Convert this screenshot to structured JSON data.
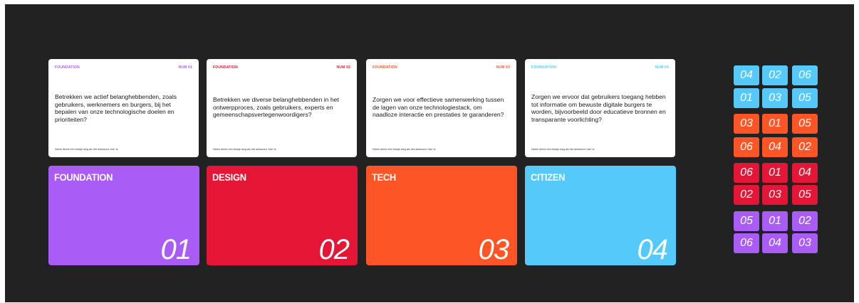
{
  "colors": {
    "board": "#222222",
    "foundation": "#aa5cf7",
    "design": "#e51535",
    "tech": "#fe5526",
    "citizen": "#55c9fa"
  },
  "question_cards": [
    {
      "category": "FOUNDATION",
      "number": "NUM 01",
      "question": "Betrekken we actief belanghebbenden, zoals gebruikers, werknemers en burgers, bij het bepalen van onze technologische doelen en prioriteiten?",
      "note": "Neem direct een blokje weg als het antwoord 'nee' is."
    },
    {
      "category": "FOUNDATION",
      "number": "NUM 02",
      "question": "Betrekken we diverse belanghebbenden in het ontwerpproces, zoals gebruikers, experts en gemeenschapsvertegenwoordigers?",
      "note": "Neem direct een blokje weg als het antwoord 'nee' is."
    },
    {
      "category": "FOUNDATION",
      "number": "NUM 03",
      "question": "Zorgen we voor effectieve samenwerking tussen de lagen van onze technologiestack, om naadloze interactie en prestaties te garanderen?",
      "note": "Neem direct een blokje weg als het antwoord 'nee' is."
    },
    {
      "category": "FOUNDATION",
      "number": "NUM 04",
      "question": "Zorgen we ervoor dat gebruikers toegang hebben tot informatie om bewuste digitale burgers te worden, bijvoorbeeld door educatieve bronnen en transparante voorlichting?",
      "note": "Neem direct een blokje weg als het antwoord 'nee' is."
    }
  ],
  "category_cards": [
    {
      "title": "FOUNDATION",
      "number": "01"
    },
    {
      "title": "DESIGN",
      "number": "02"
    },
    {
      "title": "TECH",
      "number": "03"
    },
    {
      "title": "CITIZEN",
      "number": "04"
    }
  ],
  "tiles": {
    "citizen": [
      [
        "04",
        "02",
        "06"
      ],
      [
        "01",
        "03",
        "05"
      ]
    ],
    "tech": [
      [
        "03",
        "01",
        "05"
      ],
      [
        "06",
        "04",
        "02"
      ]
    ],
    "design": [
      [
        "06",
        "01",
        "04"
      ],
      [
        "02",
        "03",
        "05"
      ]
    ],
    "foundation": [
      [
        "05",
        "01",
        "02"
      ],
      [
        "06",
        "04",
        "03"
      ]
    ]
  }
}
